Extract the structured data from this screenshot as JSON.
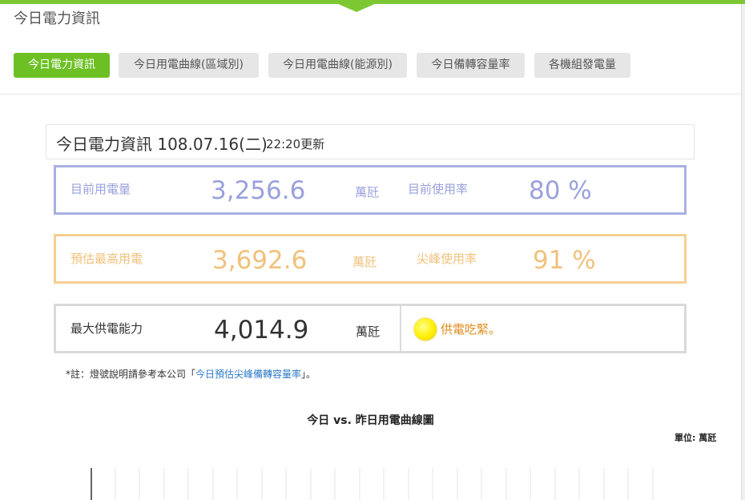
{
  "page": {
    "title": "今日電力資訊"
  },
  "tabs": [
    {
      "label": "今日電力資訊",
      "active": true
    },
    {
      "label": "今日用電曲線(區域別)",
      "active": false
    },
    {
      "label": "今日用電曲線(能源別)",
      "active": false
    },
    {
      "label": "今日備轉容量率",
      "active": false
    },
    {
      "label": "各機組發電量",
      "active": false
    }
  ],
  "info": {
    "heading": "今日電力資訊 108.07.16(二)",
    "update_time": "22:20更新"
  },
  "current": {
    "label": "目前用電量",
    "value": "3,256.6",
    "unit": "萬瓩",
    "rate_label": "目前使用率",
    "rate_value": "80 %"
  },
  "peak": {
    "label": "預估最高用電",
    "value": "3,692.6",
    "unit": "萬瓩",
    "rate_label": "尖峰使用率",
    "rate_value": "91 %"
  },
  "supply": {
    "label": "最大供電能力",
    "value": "4,014.9",
    "unit": "萬瓩",
    "status_text": "供電吃緊。",
    "lamp_color": "#ffee00"
  },
  "note": {
    "prefix": "*註：燈號說明請參考本公司「",
    "link_text": "今日預估尖峰備轉容量率",
    "suffix": "」。"
  },
  "chart": {
    "title": "今日 vs. 昨日用電曲線圖",
    "unit_label": "單位: 萬瓩"
  },
  "colors": {
    "accent": "#6cc024",
    "current": "#9aa1dc",
    "peak": "#f1c17b",
    "status": "#e28b1c",
    "link": "#2a78c8"
  }
}
